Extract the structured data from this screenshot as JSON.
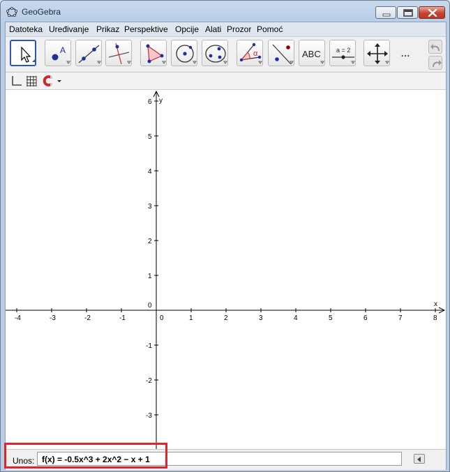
{
  "window": {
    "title": "GeoGebra",
    "controls": [
      "minimize-icon",
      "maximize-icon",
      "close-icon"
    ]
  },
  "menubar": {
    "items": [
      "Datoteka",
      "Uređivanje",
      "Prikaz",
      "Perspektive",
      "Opcije",
      "Alati",
      "Prozor",
      "Pomoć"
    ]
  },
  "toolbar": {
    "tools": [
      {
        "name": "move-tool",
        "icon": "arrow-cursor-icon",
        "active": true
      },
      {
        "name": "point-tool",
        "icon": "point-icon"
      },
      {
        "name": "line-tool",
        "icon": "line-through-two-points-icon"
      },
      {
        "name": "perpendicular-line-tool",
        "icon": "perpendicular-line-icon"
      },
      {
        "name": "polygon-tool",
        "icon": "polygon-icon"
      },
      {
        "name": "circle-tool",
        "icon": "circle-center-point-icon"
      },
      {
        "name": "conic-tool",
        "icon": "ellipse-icon"
      },
      {
        "name": "angle-tool",
        "icon": "angle-icon",
        "label": "α"
      },
      {
        "name": "reflect-tool",
        "icon": "reflect-about-line-icon"
      },
      {
        "name": "text-tool",
        "icon": "text-icon",
        "label": "ABC"
      },
      {
        "name": "slider-tool",
        "icon": "slider-icon",
        "label": "a = 2"
      },
      {
        "name": "move-graphics-view-tool",
        "icon": "move-graphics-view-icon"
      }
    ],
    "more_label": "...",
    "undo_icon": "undo-icon",
    "redo_icon": "redo-icon"
  },
  "stylebar": {
    "items": [
      "axes-toggle-icon",
      "grid-toggle-icon",
      "point-capturing-magnet-icon",
      "dropdown-arrow-icon"
    ]
  },
  "graphics_view": {
    "x_axis_label": "x",
    "y_axis_label": "y",
    "x_ticks": [
      "-4",
      "-3",
      "-2",
      "-1",
      "0",
      "1",
      "2",
      "3",
      "4",
      "5",
      "6",
      "7",
      "8"
    ],
    "y_ticks": [
      "6",
      "5",
      "4",
      "3",
      "2",
      "1",
      "0",
      "-1",
      "-2",
      "-3"
    ],
    "x_range": [
      -4.3,
      8.3
    ],
    "y_range": [
      -4.0,
      6.3
    ],
    "axis_color": "#000000"
  },
  "inputbar": {
    "label": "Unos:",
    "value": "f(x) = -0.5x^3 + 2x^2 − x  + 1",
    "help_icon": "input-help-triangle-icon"
  },
  "colors": {
    "highlight_box": "#e0242b",
    "active_tool_border": "#2e55b5",
    "point_blue": "#1f2e9a",
    "point_red": "#8b0000"
  }
}
